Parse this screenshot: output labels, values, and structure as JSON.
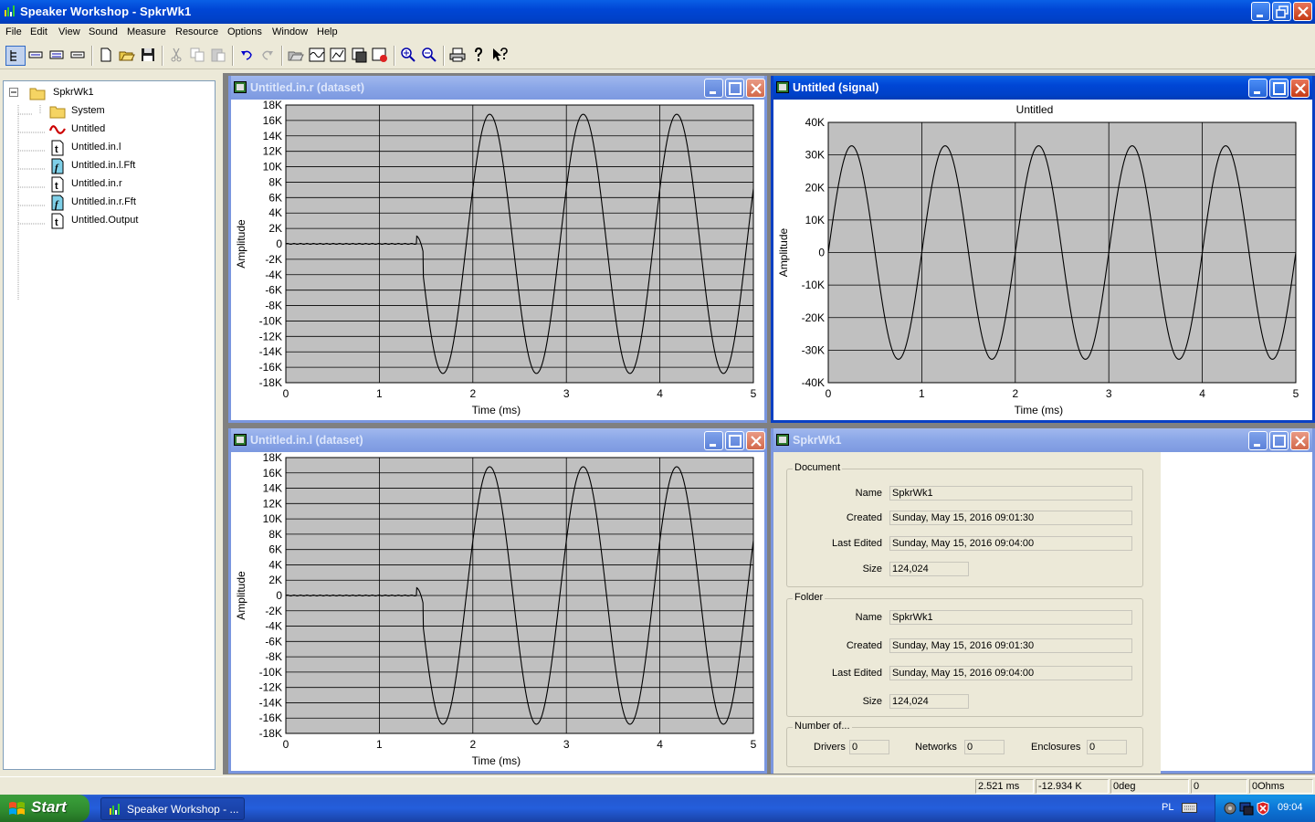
{
  "app": {
    "title": "Speaker Workshop - SpkrWk1"
  },
  "menu": [
    "File",
    "Edit",
    "View",
    "Sound",
    "Measure",
    "Resource",
    "Options",
    "Window",
    "Help"
  ],
  "toolbar": {
    "icons": [
      "tree-view-icon",
      "tool-1-icon",
      "tool-2-icon",
      "tool-3-icon",
      "new-icon",
      "open-icon",
      "save-icon",
      "cut-icon",
      "copy-icon",
      "paste-icon",
      "undo-icon",
      "redo-icon",
      "open-folder-icon",
      "waveform-icon",
      "chart-icon",
      "calc-icon",
      "run-icon",
      "zoom-in-icon",
      "zoom-out-icon",
      "print-icon",
      "help-icon",
      "context-help-icon"
    ]
  },
  "tree": {
    "root": "SpkrWk1",
    "items": [
      {
        "label": "System",
        "icon": "folder-icon"
      },
      {
        "label": "Untitled",
        "icon": "signal-icon"
      },
      {
        "label": "Untitled.in.l",
        "icon": "dataset-icon"
      },
      {
        "label": "Untitled.in.l.Fft",
        "icon": "fft-icon"
      },
      {
        "label": "Untitled.in.r",
        "icon": "dataset-icon"
      },
      {
        "label": "Untitled.in.r.Fft",
        "icon": "fft-icon"
      },
      {
        "label": "Untitled.Output",
        "icon": "dataset-icon"
      }
    ]
  },
  "windows": {
    "in_r": {
      "title": "Untitled.in.r (dataset)"
    },
    "signal": {
      "title": "Untitled (signal)"
    },
    "in_l": {
      "title": "Untitled.in.l (dataset)"
    },
    "info": {
      "title": "SpkrWk1"
    }
  },
  "chart_data": [
    {
      "id": "in_r",
      "type": "line",
      "title": "",
      "xlabel": "Time (ms)",
      "ylabel": "Amplitude",
      "xlim": [
        0,
        5
      ],
      "ylim": [
        -18000,
        18000
      ],
      "xticks": [
        "0",
        "1",
        "2",
        "3",
        "4",
        "5"
      ],
      "yticks": [
        "18K",
        "16K",
        "14K",
        "12K",
        "10K",
        "8K",
        "6K",
        "4K",
        "2K",
        "0",
        "-2K",
        "-4K",
        "-6K",
        "-8K",
        "-10K",
        "-12K",
        "-14K",
        "-16K",
        "-18K"
      ],
      "grid": true,
      "series": [
        {
          "quiet_until_ms": 1.4,
          "onset_ms": 1.41,
          "amplitude": 16800,
          "frequency_khz": 1.0,
          "phase_ms_at_first_trough": 1.68
        }
      ]
    },
    {
      "id": "signal",
      "type": "line",
      "title": "Untitled",
      "xlabel": "Time (ms)",
      "ylabel": "Amplitude",
      "xlim": [
        0,
        5
      ],
      "ylim": [
        -40000,
        40000
      ],
      "xticks": [
        "0",
        "1",
        "2",
        "3",
        "4",
        "5"
      ],
      "yticks": [
        "40K",
        "30K",
        "20K",
        "10K",
        "0",
        "-10K",
        "-20K",
        "-30K",
        "-40K"
      ],
      "grid": true,
      "series": [
        {
          "quiet_until_ms": 0,
          "amplitude": 32800,
          "frequency_khz": 1.0,
          "first_peak_ms": 0.25
        }
      ]
    },
    {
      "id": "in_l",
      "type": "line",
      "title": "",
      "xlabel": "Time (ms)",
      "ylabel": "Amplitude",
      "xlim": [
        0,
        5
      ],
      "ylim": [
        -18000,
        18000
      ],
      "xticks": [
        "0",
        "1",
        "2",
        "3",
        "4",
        "5"
      ],
      "yticks": [
        "18K",
        "16K",
        "14K",
        "12K",
        "10K",
        "8K",
        "6K",
        "4K",
        "2K",
        "0",
        "-2K",
        "-4K",
        "-6K",
        "-8K",
        "-10K",
        "-12K",
        "-14K",
        "-16K",
        "-18K"
      ],
      "grid": true,
      "series": [
        {
          "quiet_until_ms": 1.4,
          "onset_ms": 1.41,
          "amplitude": 16800,
          "frequency_khz": 1.0,
          "phase_ms_at_first_trough": 1.68
        }
      ]
    }
  ],
  "info": {
    "document": {
      "group_label": "Document",
      "name_label": "Name",
      "name": "SpkrWk1",
      "created_label": "Created",
      "created": "Sunday, May 15, 2016 09:01:30",
      "edited_label": "Last Edited",
      "edited": "Sunday, May 15, 2016 09:04:00",
      "size_label": "Size",
      "size": "124,024"
    },
    "folder": {
      "group_label": "Folder",
      "name_label": "Name",
      "name": "SpkrWk1",
      "created_label": "Created",
      "created": "Sunday, May 15, 2016 09:01:30",
      "edited_label": "Last Edited",
      "edited": "Sunday, May 15, 2016 09:04:00",
      "size_label": "Size",
      "size": "124,024"
    },
    "counts": {
      "group_label": "Number of...",
      "drivers_label": "Drivers",
      "drivers": "0",
      "networks_label": "Networks",
      "networks": "0",
      "enclosures_label": "Enclosures",
      "enclosures": "0"
    }
  },
  "status": {
    "time": "2.521  ms",
    "value": "-12.934 K",
    "phase": "0deg",
    "extra": "0",
    "impedance": "0Ohms"
  },
  "taskbar": {
    "start": "Start",
    "task": "Speaker Workshop - ...",
    "lang": "PL",
    "clock": "09:04"
  }
}
